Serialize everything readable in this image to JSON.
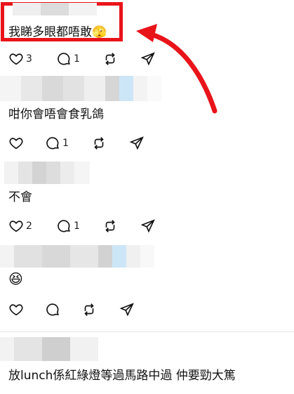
{
  "colors": {
    "annotation": "#e8141a",
    "divider": "#e5e5e5",
    "blur_blue": "#cce6f7"
  },
  "posts": [
    {
      "text": "我睇多眼都唔敢🫣",
      "likes": "3",
      "replies": "1"
    },
    {
      "text": "咁你會唔會食乳鴿",
      "likes": "",
      "replies": "1"
    },
    {
      "text": "不會",
      "likes": "2",
      "replies": "1"
    },
    {
      "text": "😆",
      "likes": "",
      "replies": ""
    },
    {
      "text": "放lunch係紅綠燈等過馬路中過 仲要勁大篤"
    }
  ],
  "icons": [
    "heart-icon",
    "comment-icon",
    "repost-icon",
    "share-icon"
  ]
}
